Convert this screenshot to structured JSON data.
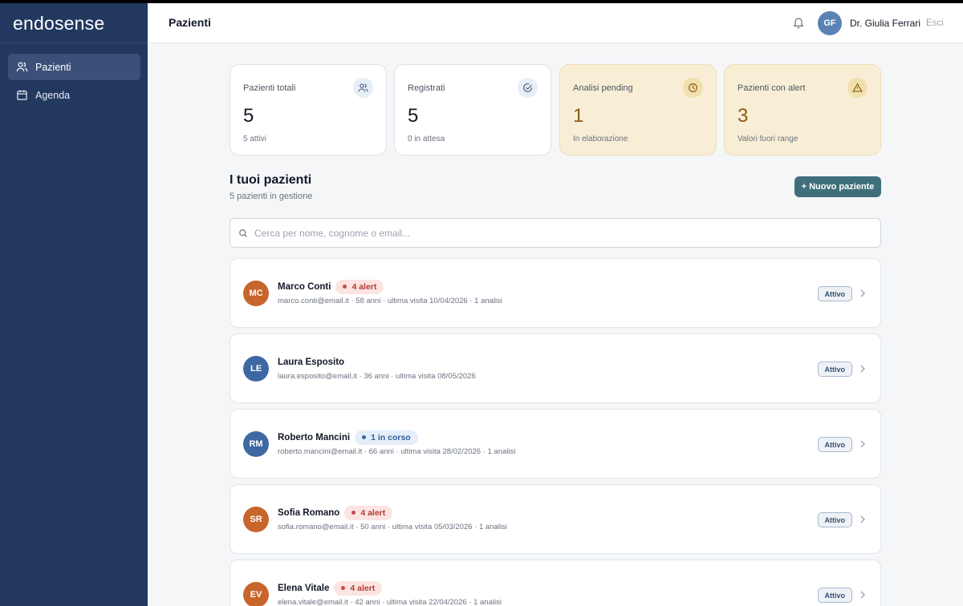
{
  "app": {
    "logo": "endosense"
  },
  "sidebar": {
    "items": [
      {
        "label": "Pazienti",
        "icon": "users-icon",
        "active": true
      },
      {
        "label": "Agenda",
        "icon": "calendar-icon",
        "active": false
      }
    ]
  },
  "header": {
    "title": "Pazienti",
    "avatar_initials": "GF",
    "user_name": "Dr. Giulia Ferrari",
    "logout_label": "Esci"
  },
  "stats": [
    {
      "label": "Pazienti totali",
      "value": "5",
      "sub": "5 attivi",
      "icon": "users-icon",
      "tone": "default"
    },
    {
      "label": "Registrati",
      "value": "5",
      "sub": "0 in attesa",
      "icon": "check-circle-icon",
      "tone": "default"
    },
    {
      "label": "Analisi pending",
      "value": "1",
      "sub": "In elaborazione",
      "icon": "clock-icon",
      "tone": "warn"
    },
    {
      "label": "Pazienti con alert",
      "value": "3",
      "sub": "Valori fuori range",
      "icon": "alert-triangle-icon",
      "tone": "warn"
    }
  ],
  "patients_section": {
    "title": "I tuoi pazienti",
    "subtitle": "5 pazienti in gestione",
    "new_button": "+ Nuovo paziente"
  },
  "search": {
    "placeholder": "Cerca per nome, cognome o email...",
    "value": ""
  },
  "patients": [
    {
      "initials": "MC",
      "name": "Marco Conti",
      "badge": "4 alert",
      "badge_type": "alert",
      "meta": "marco.conti@email.it · 58 anni · ultima visita 10/04/2026 · 1 analisi",
      "status": "Attivo",
      "avatar_color": "#c8652c"
    },
    {
      "initials": "LE",
      "name": "Laura Esposito",
      "badge": "",
      "badge_type": "none",
      "meta": "laura.esposito@email.it · 36 anni · ultima visita 08/05/2026",
      "status": "Attivo",
      "avatar_color": "#3d68a3"
    },
    {
      "initials": "RM",
      "name": "Roberto Mancini",
      "badge": "1 in corso",
      "badge_type": "info",
      "meta": "roberto.mancini@email.it · 66 anni · ultima visita 28/02/2026 · 1 analisi",
      "status": "Attivo",
      "avatar_color": "#3d68a3"
    },
    {
      "initials": "SR",
      "name": "Sofia Romano",
      "badge": "4 alert",
      "badge_type": "alert",
      "meta": "sofia.romano@email.it · 50 anni · ultima visita 05/03/2026 · 1 analisi",
      "status": "Attivo",
      "avatar_color": "#c8652c"
    },
    {
      "initials": "EV",
      "name": "Elena Vitale",
      "badge": "4 alert",
      "badge_type": "alert",
      "meta": "elena.vitale@email.it · 42 anni · ultima visita 22/04/2026 · 1 analisi",
      "status": "Attivo",
      "avatar_color": "#c8652c"
    }
  ],
  "colors": {
    "sidebar": "#22385f",
    "primary_button": "#3e6f7a",
    "alert_badge_bg": "#fbe4e1",
    "alert_badge_text": "#b43c35",
    "info_badge_bg": "#e4edf9",
    "info_badge_text": "#315f99",
    "warn_card": "#f8eed5"
  }
}
